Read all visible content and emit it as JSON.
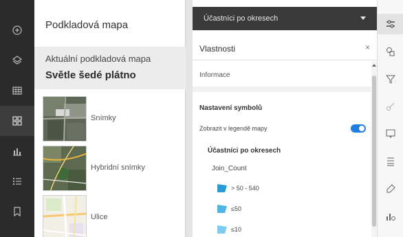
{
  "left_rail": {
    "items": [
      {
        "icon": "add-icon",
        "active": false
      },
      {
        "icon": "layers-icon",
        "active": false
      },
      {
        "icon": "table-icon",
        "active": false
      },
      {
        "icon": "basemap-gallery-icon",
        "active": true
      },
      {
        "icon": "charts-icon",
        "active": false
      },
      {
        "icon": "legend-icon",
        "active": false
      },
      {
        "icon": "bookmark-icon",
        "active": false
      }
    ]
  },
  "basemap": {
    "title": "Podkladová mapa",
    "current_label": "Aktuální podkladová mapa",
    "current_value": "Světle šedé plátno",
    "items": [
      {
        "label": "Snímky",
        "icon": "imagery-thumbnail"
      },
      {
        "label": "Hybridní snímky",
        "icon": "hybrid-imagery-thumbnail"
      },
      {
        "label": "Ulice",
        "icon": "streets-thumbnail"
      }
    ]
  },
  "properties": {
    "layer_select": "Účastníci po okresech",
    "title": "Vlastnosti",
    "close": "×",
    "info": "Informace",
    "symbol_settings": "Nastavení symbolů",
    "show_in_legend": "Zobrazit v legendě mapy",
    "show_in_legend_on": true,
    "layer_name": "Účastníci po okresech",
    "field": "Join_Count",
    "classes": [
      {
        "label": "> 50 - 540",
        "color": "#2b9bd6"
      },
      {
        "label": "≤50",
        "color": "#52b4e3"
      },
      {
        "label": "≤10",
        "color": "#7fcbef"
      }
    ]
  },
  "right_rail": {
    "items": [
      {
        "icon": "properties-icon",
        "active": true
      },
      {
        "icon": "styles-icon",
        "active": false
      },
      {
        "icon": "filter-icon",
        "active": false
      },
      {
        "icon": "effects-icon",
        "active": false
      },
      {
        "icon": "popups-icon",
        "active": false
      },
      {
        "icon": "fields-icon",
        "active": false
      },
      {
        "icon": "labels-icon",
        "active": false
      },
      {
        "icon": "configure-charts-icon",
        "active": false
      }
    ]
  },
  "colors": {
    "left_rail_bg": "#2b2b2b",
    "accent_toggle": "#1f7ee0",
    "layer_select_bg": "#3a3a3a"
  }
}
